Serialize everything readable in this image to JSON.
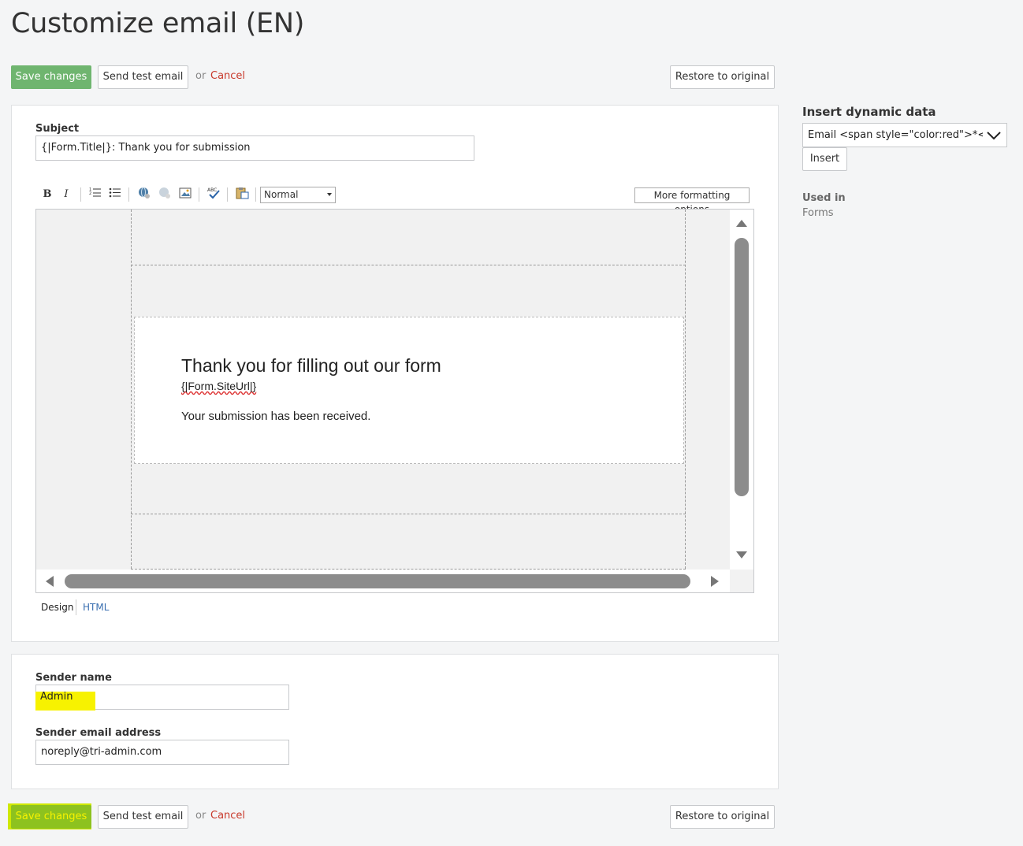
{
  "page": {
    "title": "Customize email (EN)"
  },
  "actions": {
    "save_label": "Save changes",
    "test_label": "Send test email",
    "or_label": "or",
    "cancel_label": "Cancel",
    "restore_label": "Restore to original"
  },
  "subject": {
    "label": "Subject",
    "value": "{|Form.Title|}: Thank you for submission"
  },
  "toolbar": {
    "bold": "B",
    "italic": "I",
    "format_select": "Normal",
    "more_label": "More formatting options"
  },
  "editor": {
    "heading": "Thank you for filling out our form",
    "site_url": "{|Form.SiteUrl|}",
    "body": "Your submission has been received.",
    "tab_design": "Design",
    "tab_html": "HTML"
  },
  "sender": {
    "name_label": "Sender name",
    "name_value": "Admin",
    "email_label": "Sender email address",
    "email_value": "noreply@tri-admin.com"
  },
  "sidebar": {
    "insert_title": "Insert dynamic data",
    "select_value": "Email <span style=\"color:red\">*</span>",
    "insert_button": "Insert",
    "used_in_title": "Used in",
    "used_in_value": "Forms"
  },
  "colors": {
    "primary": "#6fb56f",
    "cancel": "#c8392b",
    "highlight": "#f7f200",
    "link": "#3a6fb0"
  }
}
